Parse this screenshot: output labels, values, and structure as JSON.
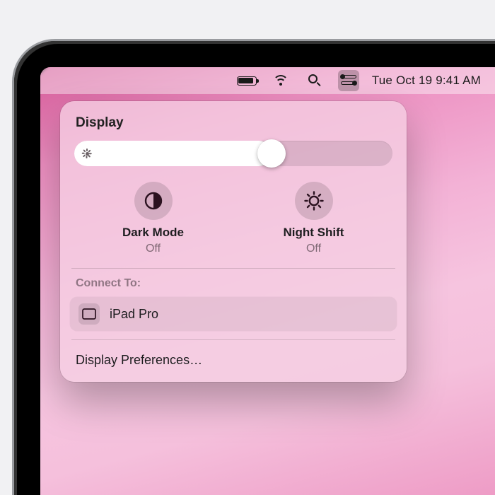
{
  "menubar": {
    "clock": "Tue Oct 19  9:41 AM",
    "battery_level_pct": 80,
    "control_center_active": true
  },
  "popover": {
    "title": "Display",
    "brightness_pct": 62,
    "toggles": [
      {
        "id": "dark-mode",
        "label": "Dark Mode",
        "state": "Off"
      },
      {
        "id": "night-shift",
        "label": "Night Shift",
        "state": "Off"
      }
    ],
    "connect_label": "Connect To:",
    "devices": [
      {
        "name": "iPad Pro",
        "icon": "ipad-icon"
      }
    ],
    "prefs_label": "Display Preferences…"
  }
}
